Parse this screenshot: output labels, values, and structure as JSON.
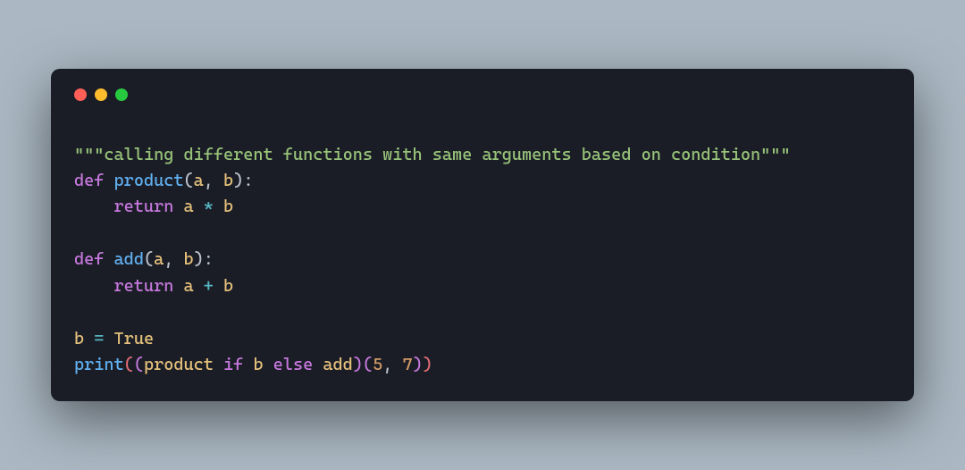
{
  "traffic_lights": {
    "red": "#ff5f56",
    "yellow": "#ffbd2e",
    "green": "#27c93f"
  },
  "code": {
    "docstring_open": "\"\"\"",
    "docstring_text": "calling different functions with same arguments based on condition",
    "docstring_close": "\"\"\"",
    "kw_def_1": "def",
    "sp": " ",
    "fn_product": "product",
    "lp": "(",
    "id_a": "a",
    "comma": ", ",
    "id_b": "b",
    "rp": ")",
    "colon": ":",
    "indent": "    ",
    "kw_return_1": "return",
    "sp_ret": " ",
    "op_mul": "*",
    "kw_def_2": "def",
    "fn_add": "add",
    "kw_return_2": "return",
    "op_add": "+",
    "assign_b": "b",
    "op_eq": " = ",
    "true_lit": "True",
    "fn_print": "print",
    "print_lp": "(",
    "inner_lp": "(",
    "id_product": "product",
    "kw_if": "if",
    "cond_b": "b",
    "kw_else": "else",
    "id_add": "add",
    "inner_rp": ")",
    "call_lp": "(",
    "num_5": "5",
    "num_7": "7",
    "call_rp": ")",
    "print_rp": ")"
  }
}
